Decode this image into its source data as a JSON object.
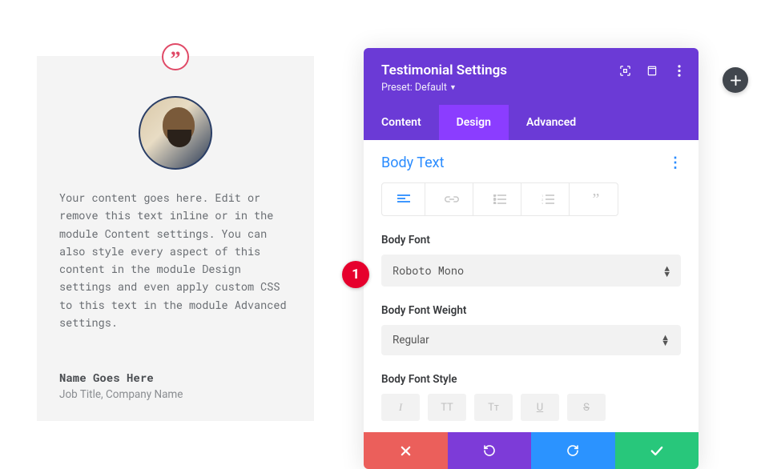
{
  "testimonial": {
    "body": "Your content goes here. Edit or remove this text inline or in the module Content settings. You can also style every aspect of this content in the module Design settings and even apply custom CSS to this text in the module Advanced settings.",
    "name": "Name Goes Here",
    "title": "Job Title, Company Name"
  },
  "panel": {
    "title": "Testimonial Settings",
    "preset": "Preset: Default"
  },
  "tabs": {
    "content": "Content",
    "design": "Design",
    "advanced": "Advanced"
  },
  "section": {
    "title": "Body Text"
  },
  "fields": {
    "body_font_label": "Body Font",
    "body_font_value": "Roboto Mono",
    "body_font_weight_label": "Body Font Weight",
    "body_font_weight_value": "Regular",
    "body_font_style_label": "Body Font Style"
  },
  "style_buttons": {
    "italic": "I",
    "uppercase": "TT",
    "smallcaps": "Tᴛ"
  },
  "marker": {
    "num": "1"
  }
}
